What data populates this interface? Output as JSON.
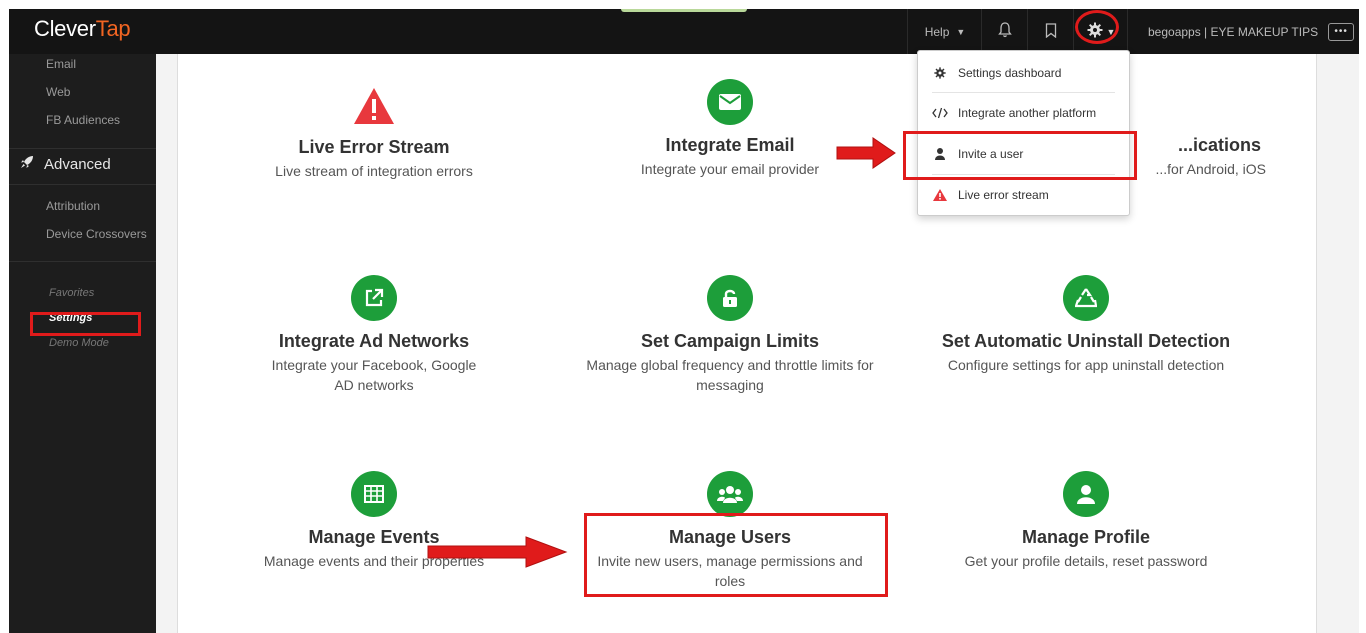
{
  "topbar": {
    "logo_left": "Clever",
    "logo_right": "Tap",
    "help_label": "Help",
    "account_label": "begoapps | EYE MAKEUP TIPS"
  },
  "sidebar": {
    "top_links": [
      "Email",
      "Web",
      "FB Audiences"
    ],
    "advanced_label": "Advanced",
    "advanced_links": [
      "Attribution",
      "Device Crossovers"
    ],
    "favorites_label": "Favorites",
    "settings_label": "Settings",
    "demo_label": "Demo Mode"
  },
  "cards": [
    {
      "title": "Live Error Stream",
      "desc": "Live stream of integration errors",
      "icon": "warning-icon"
    },
    {
      "title": "Integrate Email",
      "desc": "Integrate your email provider",
      "icon": "envelope-icon"
    },
    {
      "title": "...ications",
      "desc": "...for Android, iOS",
      "icon": "mobile-icon"
    },
    {
      "title": "Integrate Ad Networks",
      "desc": "Integrate your Facebook, Google AD networks",
      "icon": "external-link-icon"
    },
    {
      "title": "Set Campaign Limits",
      "desc": "Manage global frequency and throttle limits for messaging",
      "icon": "unlock-icon"
    },
    {
      "title": "Set Automatic Uninstall Detection",
      "desc": "Configure settings for app uninstall detection",
      "icon": "recycle-icon"
    },
    {
      "title": "Manage Events",
      "desc": "Manage events and their properties",
      "icon": "table-icon"
    },
    {
      "title": "Manage Users",
      "desc": "Invite new users, manage permissions and roles",
      "icon": "users-icon"
    },
    {
      "title": "Manage Profile",
      "desc": "Get your profile details, reset password",
      "icon": "user-icon"
    }
  ],
  "dropdown": {
    "settings_dashboard": "Settings dashboard",
    "integrate_platform": "Integrate another platform",
    "invite_user": "Invite a user",
    "live_error_stream": "Live error stream"
  },
  "colors": {
    "accent_green": "#1d9e3a",
    "brand_orange": "#f26522",
    "annotation_red": "#e01b1b",
    "alert_red": "#e8383d"
  }
}
